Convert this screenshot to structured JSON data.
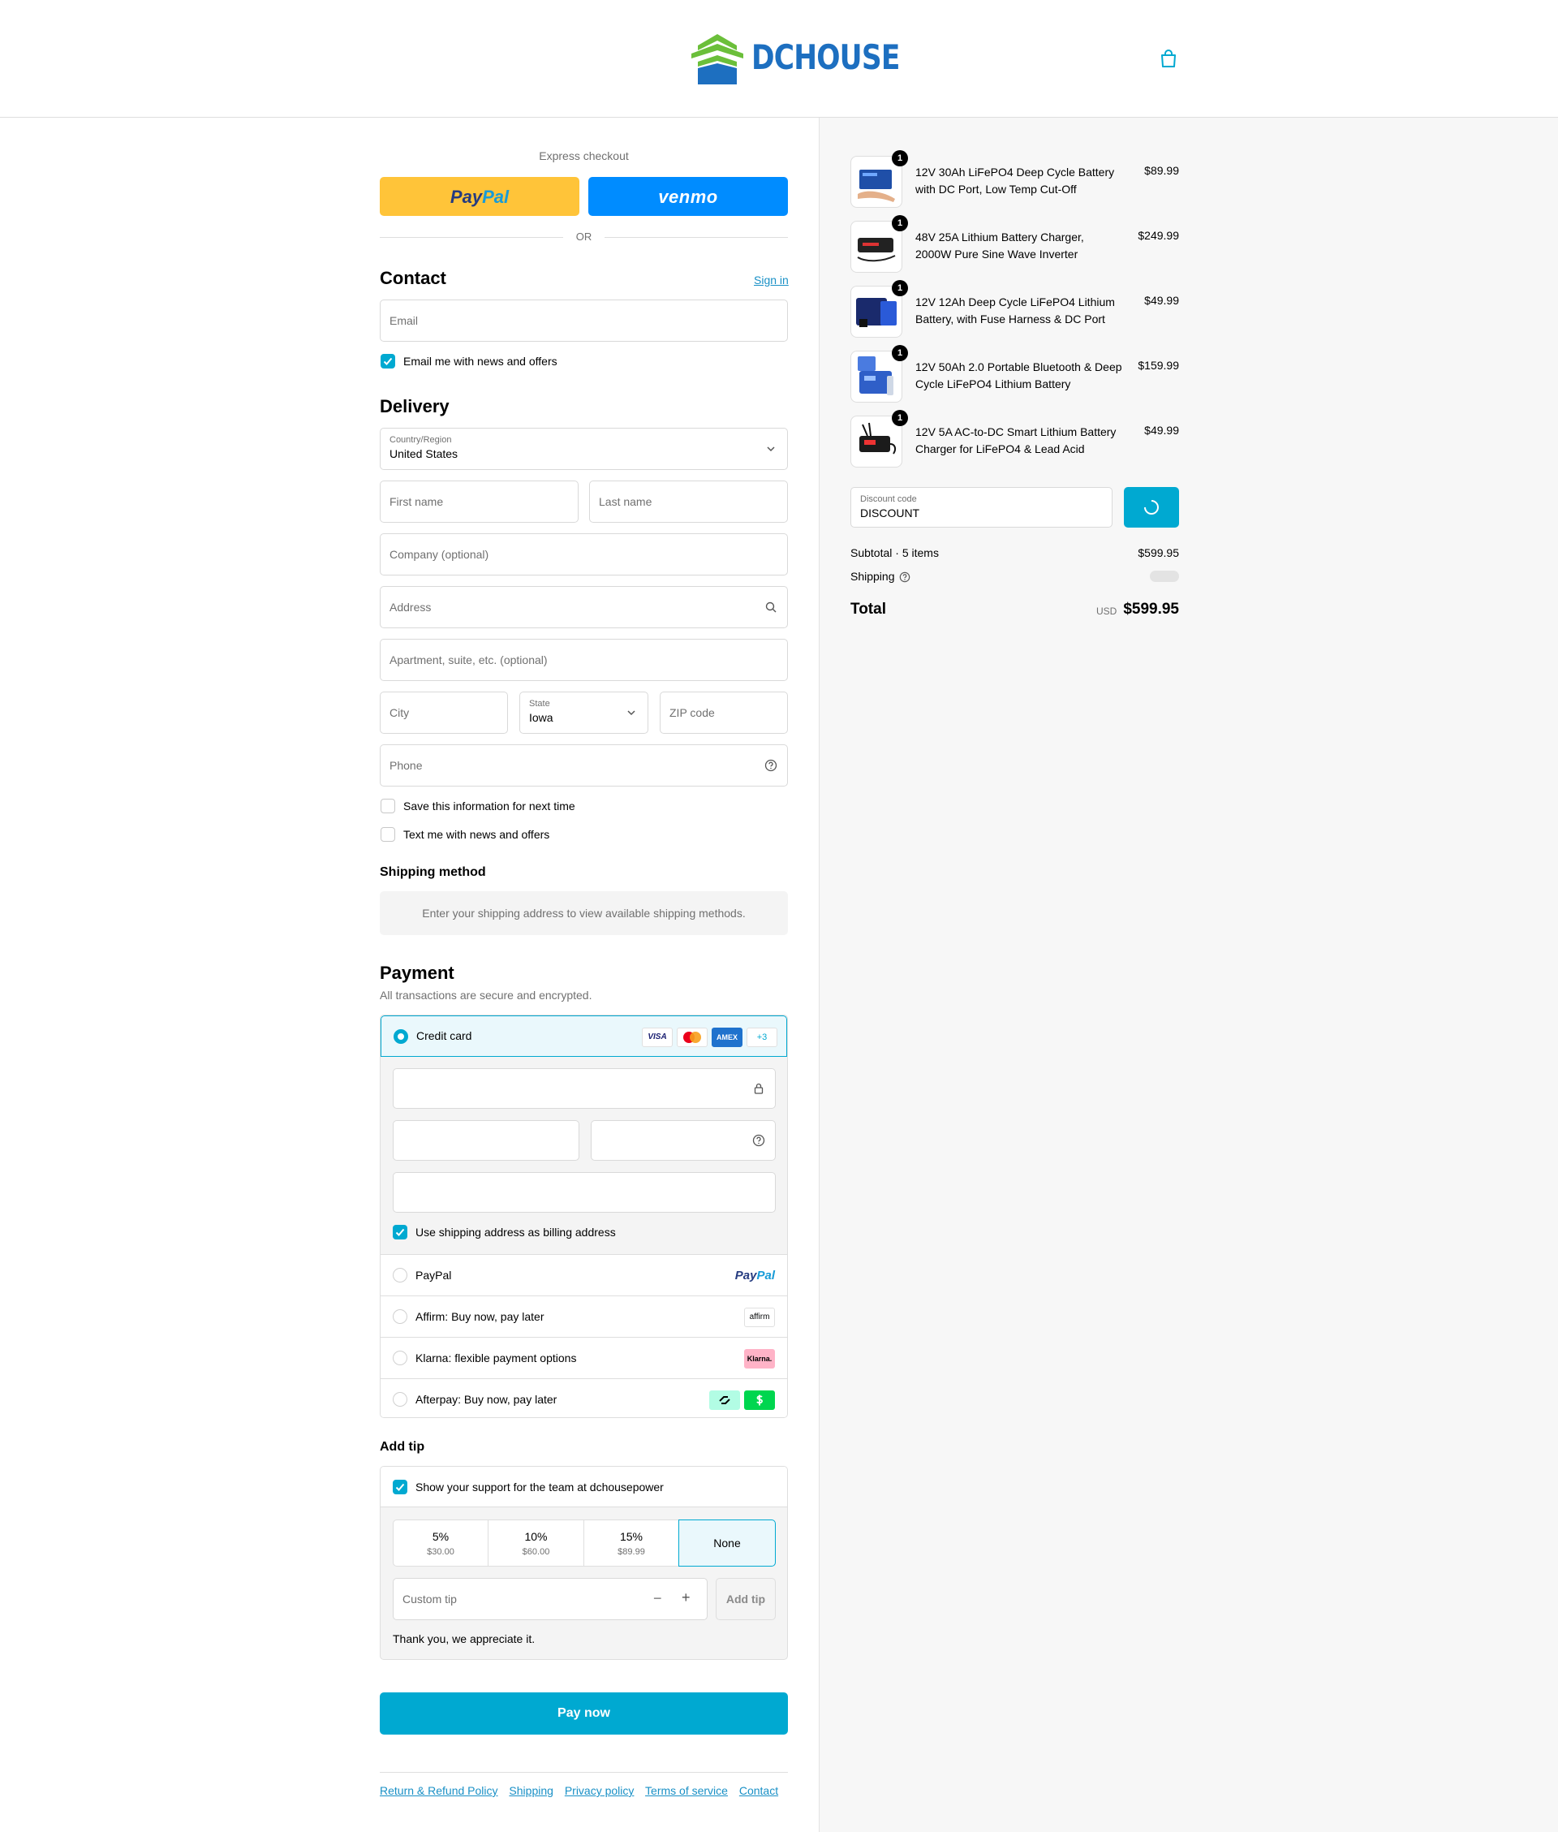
{
  "header": {
    "brand": "DCHOUSE",
    "colors": {
      "brand_blue": "#1d6fc0",
      "brand_green": "#6bbf3a"
    }
  },
  "express": {
    "title": "Express checkout",
    "paypal": {
      "pay": "Pay",
      "pal": "Pal"
    },
    "venmo": "venmo",
    "or": "OR"
  },
  "contact": {
    "title": "Contact",
    "sign_in": "Sign in",
    "email_placeholder": "Email",
    "news_label": "Email me with news and offers"
  },
  "delivery": {
    "title": "Delivery",
    "country_label": "Country/Region",
    "country_value": "United States",
    "first_name": "First name",
    "last_name": "Last name",
    "company": "Company (optional)",
    "address": "Address",
    "apartment": "Apartment, suite, etc. (optional)",
    "city": "City",
    "state_label": "State",
    "state_value": "Iowa",
    "zip": "ZIP code",
    "phone": "Phone",
    "save_info": "Save this information for next time",
    "text_me": "Text me with news and offers"
  },
  "shipping_method": {
    "title": "Shipping method",
    "notice": "Enter your shipping address to view available shipping methods."
  },
  "payment": {
    "title": "Payment",
    "subtitle": "All transactions are secure and encrypted.",
    "credit_card": "Credit card",
    "more_cards": "+3",
    "card_logos": {
      "visa": "VISA",
      "amex": "AMEX"
    },
    "billing_same": "Use shipping address as billing address",
    "paypal": "PayPal",
    "paypal_logo": {
      "pay": "Pay",
      "pal": "Pal"
    },
    "affirm": "Affirm: Buy now, pay later",
    "affirm_logo": "affirm",
    "klarna": "Klarna: flexible payment options",
    "klarna_logo": "Klarna.",
    "afterpay": "Afterpay: Buy now, pay later",
    "accent": "#00a9d1"
  },
  "tip": {
    "title": "Add tip",
    "support": "Show your support for the team at dchousepower",
    "options": [
      {
        "pct": "5%",
        "amt": "$30.00"
      },
      {
        "pct": "10%",
        "amt": "$60.00"
      },
      {
        "pct": "15%",
        "amt": "$89.99"
      },
      {
        "pct": "None",
        "amt": ""
      }
    ],
    "custom_placeholder": "Custom tip",
    "minus": "−",
    "plus": "+",
    "add_button": "Add tip",
    "thanks": "Thank you, we appreciate it."
  },
  "pay_now": "Pay now",
  "footer": {
    "links": [
      "Return & Refund Policy",
      "Shipping",
      "Privacy policy",
      "Terms of service",
      "Contact"
    ]
  },
  "order": {
    "items": [
      {
        "qty": "1",
        "name": "12V 30Ah LiFePO4 Deep Cycle Battery with DC Port, Low Temp Cut-Off",
        "price": "$89.99"
      },
      {
        "qty": "1",
        "name": "48V 25A Lithium Battery Charger, 2000W Pure Sine Wave Inverter",
        "price": "$249.99"
      },
      {
        "qty": "1",
        "name": "12V 12Ah Deep Cycle LiFePO4 Lithium Battery, with Fuse Harness & DC Port",
        "price": "$49.99"
      },
      {
        "qty": "1",
        "name": "12V 50Ah 2.0 Portable Bluetooth & Deep Cycle LiFePO4 Lithium Battery",
        "price": "$159.99"
      },
      {
        "qty": "1",
        "name": "12V 5A AC-to-DC Smart Lithium Battery Charger for LiFePO4 & Lead Acid",
        "price": "$49.99"
      }
    ],
    "discount_label": "Discount code",
    "discount_value": "DISCOUNT",
    "subtotal_label": "Subtotal · 5 items",
    "subtotal_value": "$599.95",
    "shipping_label": "Shipping",
    "total_label": "Total",
    "currency": "USD",
    "total_value": "$599.95"
  }
}
